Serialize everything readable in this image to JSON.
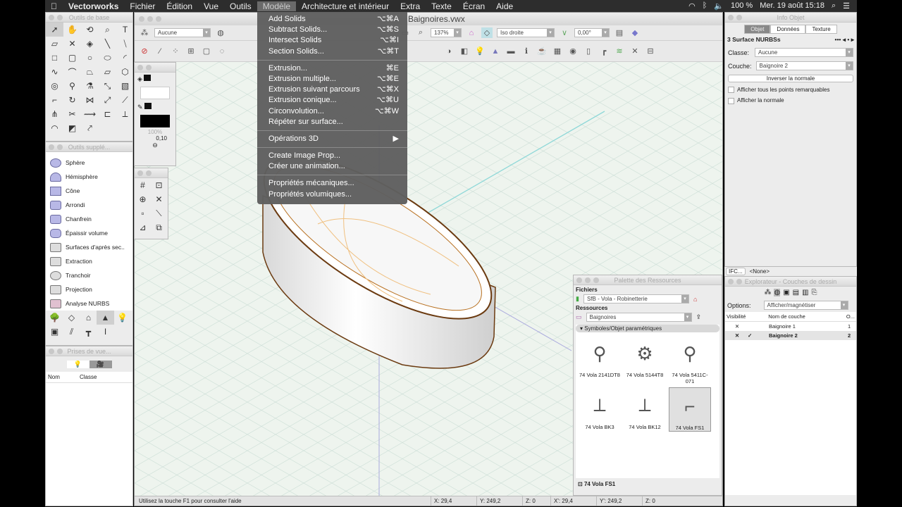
{
  "menubar": {
    "apple": "",
    "app": "Vectorworks",
    "items": [
      "Fichier",
      "Édition",
      "Vue",
      "Outils",
      "Modèle",
      "Architecture et intérieur",
      "Extra",
      "Texte",
      "Écran",
      "Aide"
    ],
    "battery": "100 %",
    "clock": "Mer. 19 août  15:18"
  },
  "menu": {
    "items": [
      {
        "label": "Add Solids",
        "shortcut": "⌥⌘A"
      },
      {
        "label": "Subtract Solids...",
        "shortcut": "⌥⌘S"
      },
      {
        "label": "Intersect Solids",
        "shortcut": "⌥⌘I"
      },
      {
        "label": "Section Solids...",
        "shortcut": "⌥⌘T"
      },
      {
        "label": "Extrusion...",
        "shortcut": "⌘E"
      },
      {
        "label": "Extrusion multiple...",
        "shortcut": "⌥⌘E"
      },
      {
        "label": "Extrusion suivant parcours",
        "shortcut": "⌥⌘X"
      },
      {
        "label": "Extrusion conique...",
        "shortcut": "⌥⌘U"
      },
      {
        "label": "Circonvolution...",
        "shortcut": "⌥⌘W"
      },
      {
        "label": "Répéter sur surface...",
        "shortcut": ""
      },
      {
        "label": "Opérations 3D",
        "shortcut": "▶"
      },
      {
        "label": "Create Image Prop...",
        "shortcut": ""
      },
      {
        "label": "Créer une animation...",
        "shortcut": ""
      },
      {
        "label": "Propriétés mécaniques...",
        "shortcut": ""
      },
      {
        "label": "Propriétés volumiques...",
        "shortcut": ""
      }
    ]
  },
  "basic_tools": {
    "title": "Outils de base"
  },
  "attributes": {
    "opacity": "100%",
    "line_weight": "0,10"
  },
  "extra_tools": {
    "title": "Outils supplé...",
    "items": [
      "Sphère",
      "Hémisphère",
      "Cône",
      "Arrondi",
      "Chanfrein",
      "Épaissir volume",
      "Surfaces d'après sec..",
      "Extraction",
      "Tranchoir",
      "Projection",
      "Analyse NURBS"
    ]
  },
  "views": {
    "title": "Prises de vue...",
    "col_name": "Nom",
    "col_class": "Classe"
  },
  "document": {
    "title": "Baignoires.vwx",
    "class_select": "Aucune",
    "zoom": "137%",
    "view": "Iso droite",
    "angle": "0,00°"
  },
  "status": {
    "help": "Utilisez la touche F1 pour consulter l'aide",
    "x": "X:  29,4",
    "y": "Y:  249,2",
    "z": "Z:  0",
    "x2": "X':  29,4",
    "y2": "Y':  249,2",
    "z2": "Z:  0"
  },
  "info": {
    "title": "Info Objet",
    "tabs": [
      "Objet",
      "Données",
      "Texture"
    ],
    "object": "3 Surface NURBSs",
    "class_label": "Classe:",
    "class_value": "Aucune",
    "layer_label": "Couche:",
    "layer_value": "Baignoire 2",
    "invert_button": "Inverser la normale",
    "check1": "Afficher tous les points remarquables",
    "check2": "Afficher la normale",
    "ifc": "IFC...",
    "ifc_value": "<None>"
  },
  "explorer": {
    "title": "Explorateur - Couches de dessin",
    "options_label": "Options:",
    "options_value": "Afficher/magnétiser",
    "cols": [
      "Visibilité",
      "Nom de couche",
      "O..."
    ],
    "rows": [
      {
        "vis": "✕",
        "active": "",
        "name": "Baignoire 1",
        "order": "1"
      },
      {
        "vis": "✕",
        "active": "✓",
        "name": "Baignoire 2",
        "order": "2"
      }
    ]
  },
  "resources": {
    "title": "Palette des Ressources",
    "files_label": "Fichiers",
    "file": "SfB - Vola - Robinetterie",
    "res_label": "Ressources",
    "folder": "Baignoires",
    "section": "Symboles/Objet paramétriques",
    "items": [
      "74 Vola 2141DT8",
      "74 Vola 5144T8",
      "74 Vola 5411C-071",
      "74 Vola BK3",
      "74 Vola BK12",
      "74 Vola FS1"
    ],
    "selected": "74 Vola FS1"
  }
}
